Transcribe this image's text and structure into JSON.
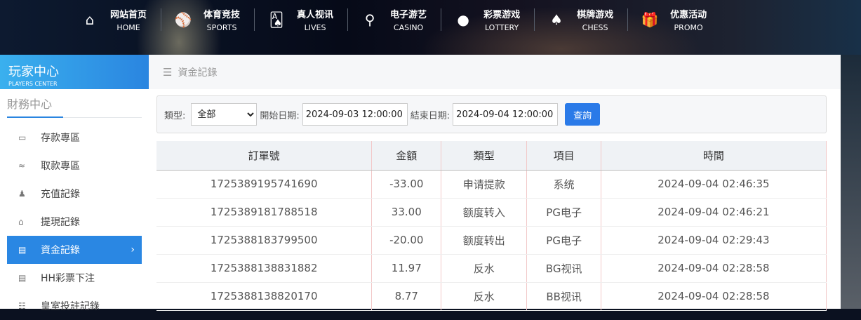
{
  "nav": [
    {
      "cn": "网站首页",
      "en": "HOME",
      "icon": "⌂",
      "name": "home"
    },
    {
      "cn": "体育竞技",
      "en": "SPORTS",
      "icon": "⚾",
      "name": "sports"
    },
    {
      "cn": "真人视讯",
      "en": "LIVES",
      "icon": "🂡",
      "name": "lives"
    },
    {
      "cn": "电子游艺",
      "en": "CASINO",
      "icon": "⚲",
      "name": "casino"
    },
    {
      "cn": "彩票游戏",
      "en": "LOTTERY",
      "icon": "●",
      "name": "lottery"
    },
    {
      "cn": "棋牌游戏",
      "en": "CHESS",
      "icon": "♠",
      "name": "chess"
    },
    {
      "cn": "优惠活动",
      "en": "PROMO",
      "icon": "🎁",
      "name": "promo"
    }
  ],
  "sidebar": {
    "title_cn": "玩家中心",
    "title_en": "PLAYERS CENTER",
    "section": "財務中心",
    "items": [
      {
        "label": "存款專區",
        "icon": "▭"
      },
      {
        "label": "取款專區",
        "icon": "≈"
      },
      {
        "label": "充值記錄",
        "icon": "♟"
      },
      {
        "label": "提現記錄",
        "icon": "⌂"
      },
      {
        "label": "資金記錄",
        "icon": "▤",
        "active": true
      },
      {
        "label": "HH彩票下注",
        "icon": "▤"
      },
      {
        "label": "皇室投註記錄",
        "icon": "☷"
      }
    ]
  },
  "breadcrumb": "資金記錄",
  "filter": {
    "type_label": "類型:",
    "type_value": "全部",
    "start_label": "開始日期:",
    "start_value": "2024-09-03 12:00:00",
    "end_label": "結束日期:",
    "end_value": "2024-09-04 12:00:00",
    "query": "查詢"
  },
  "table": {
    "headers": [
      "訂單號",
      "金額",
      "類型",
      "項目",
      "時間"
    ],
    "rows": [
      [
        "1725389195741690",
        "-33.00",
        "申请提款",
        "系统",
        "2024-09-04 02:46:35"
      ],
      [
        "1725389181788518",
        "33.00",
        "额度转入",
        "PG电子",
        "2024-09-04 02:46:21"
      ],
      [
        "1725388183799500",
        "-20.00",
        "额度转出",
        "PG电子",
        "2024-09-04 02:29:43"
      ],
      [
        "1725388138831882",
        "11.97",
        "反水",
        "BG视讯",
        "2024-09-04 02:28:58"
      ],
      [
        "1725388138820170",
        "8.77",
        "反水",
        "BB视讯",
        "2024-09-04 02:28:58"
      ]
    ]
  },
  "colors": {
    "accent": "#2a87e3",
    "button": "#2a7ae8"
  }
}
